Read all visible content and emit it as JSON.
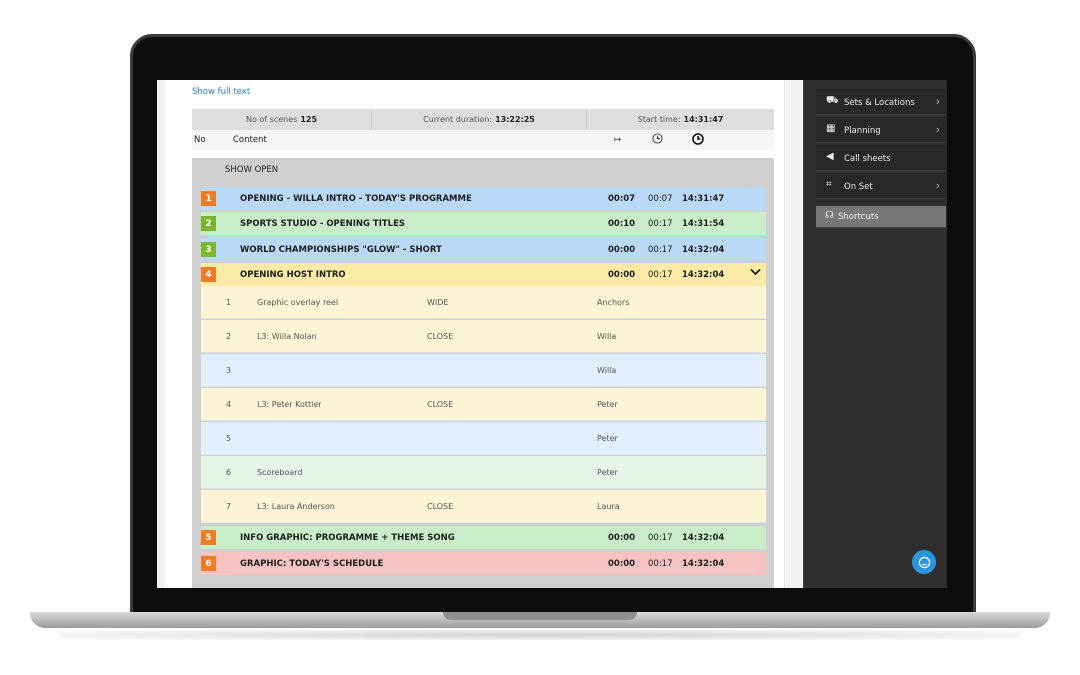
{
  "show_full_text": "Show full text",
  "stats": {
    "scenes_label": "No of scenes",
    "scenes_value": "125",
    "duration_label": "Current duration:",
    "duration_value": "13:22:25",
    "start_label": "Start time:",
    "start_value": "14:31:47"
  },
  "columns": {
    "no": "No",
    "content": "Content",
    "width_icon": "↦",
    "clock_icon": "clock-icon",
    "clock_bold_icon": "clock-icon"
  },
  "group_title": "SHOW OPEN",
  "scenes": [
    {
      "num": "1",
      "title": "OPENING - WILLA INTRO - TODAY'S PROGRAMME",
      "dur": "00:07",
      "dur2": "00:07",
      "time": "14:31:47",
      "row_color": "#b9d9f6",
      "badge_color": "#ef7b22"
    },
    {
      "num": "2",
      "title": "SPORTS STUDIO - OPENING TITLES",
      "dur": "00:10",
      "dur2": "00:17",
      "time": "14:31:54",
      "row_color": "#c8edc8",
      "badge_color": "#78b82a"
    },
    {
      "num": "3",
      "title": "WORLD CHAMPIONSHIPS \"GLOW\" - SHORT",
      "dur": "00:00",
      "dur2": "00:17",
      "time": "14:32:04",
      "row_color": "#b9d9f6",
      "badge_color": "#78b82a"
    },
    {
      "num": "4",
      "title": "OPENING HOST INTRO",
      "dur": "00:00",
      "dur2": "00:17",
      "time": "14:32:04",
      "row_color": "#fbeba6",
      "badge_color": "#ef7b22",
      "expanded": true
    },
    {
      "num": "5",
      "title": "INFO GRAPHIC: PROGRAMME + THEME SONG",
      "dur": "00:00",
      "dur2": "00:17",
      "time": "14:32:04",
      "row_color": "#c8edc8",
      "badge_color": "#ef7b22"
    },
    {
      "num": "6",
      "title": "GRAPHIC: TODAY'S SCHEDULE",
      "dur": "00:00",
      "dur2": "00:17",
      "time": "14:32:04",
      "row_color": "#f7c2c2",
      "badge_color": "#ef7b22"
    }
  ],
  "shots": [
    {
      "no": "1",
      "content": "Graphic overlay reel",
      "size": "WIDE",
      "who": "Anchors",
      "color": "#fdf5d6"
    },
    {
      "no": "2",
      "content": "L3: Willa Nolan",
      "size": "CLOSE",
      "who": "Willa",
      "color": "#fdf5d6"
    },
    {
      "no": "3",
      "content": "",
      "size": "",
      "who": "Willa",
      "color": "#e1eefb"
    },
    {
      "no": "4",
      "content": "L3: Peter Kottler",
      "size": "CLOSE",
      "who": "Peter",
      "color": "#fdf5d6"
    },
    {
      "no": "5",
      "content": "",
      "size": "",
      "who": "Peter",
      "color": "#e1eefb"
    },
    {
      "no": "6",
      "content": "Scoreboard",
      "size": "",
      "who": "Peter",
      "color": "#e6f6e6"
    },
    {
      "no": "7",
      "content": "L3: Laura Anderson",
      "size": "CLOSE",
      "who": "Laura",
      "color": "#fdf5d6"
    }
  ],
  "sidebar": [
    {
      "label": "Sets & Locations",
      "icon": "sets-icon",
      "arrow": true
    },
    {
      "label": "Planning",
      "icon": "calendar-icon",
      "arrow": true
    },
    {
      "label": "Call sheets",
      "icon": "megaphone-icon",
      "arrow": false
    },
    {
      "label": "On Set",
      "icon": "director-chair-icon",
      "arrow": true
    },
    {
      "label": "Shortcuts",
      "icon": "headset-icon",
      "arrow": false,
      "active": true
    }
  ]
}
